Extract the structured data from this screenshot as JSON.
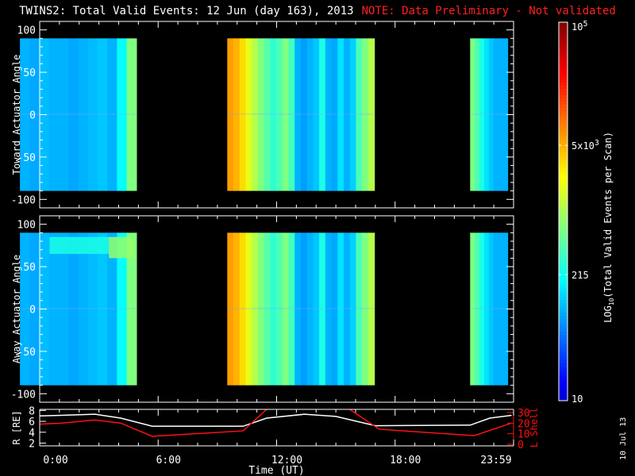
{
  "title": {
    "main": "TWINS2: Total Valid Events: 12 Jun (day 163), 2013",
    "note": "NOTE: Data Preliminary - Not validated",
    "note_color": "#ff2020"
  },
  "date_stamp": "10 Jul 13",
  "chart_data": [
    {
      "type": "heatmap",
      "name": "toward",
      "ylabel": "Toward Actuator Angle",
      "ylim": [
        -110,
        110
      ],
      "yticks": [
        100,
        50,
        0,
        -50,
        -100
      ],
      "yticklabels": [
        "100",
        "50",
        "0",
        "-50",
        "-100"
      ],
      "data_angle_range": [
        -90,
        90
      ],
      "segments": [
        {
          "start": -1.0,
          "end": 4.9,
          "levels": [
            0.3,
            0.29,
            0.31,
            0.3,
            0.3,
            0.29,
            0.3,
            0.31,
            0.32,
            0.3,
            0.38,
            0.5
          ]
        },
        {
          "start": 9.5,
          "end": 16.95,
          "levels": [
            0.72,
            0.7,
            0.66,
            0.6,
            0.55,
            0.5,
            0.46,
            0.42,
            0.45,
            0.5,
            0.44,
            0.3,
            0.28,
            0.3,
            0.32,
            0.4,
            0.3,
            0.29,
            0.35,
            0.3,
            0.33,
            0.45,
            0.5,
            0.55
          ]
        },
        {
          "start": 21.8,
          "end": 23.7,
          "levels": [
            0.5,
            0.45,
            0.4,
            0.35,
            0.32,
            0.3,
            0.3,
            0.3
          ]
        }
      ],
      "patches": []
    },
    {
      "type": "heatmap",
      "name": "away",
      "ylabel": "Away Actuator Angle",
      "ylim": [
        -110,
        110
      ],
      "yticks": [
        100,
        50,
        0,
        -50,
        -100
      ],
      "yticklabels": [
        "100",
        "50",
        "0",
        "-50",
        "-100"
      ],
      "data_angle_range": [
        -90,
        90
      ],
      "segments": [
        {
          "start": -1.0,
          "end": 4.9,
          "levels": [
            0.3,
            0.29,
            0.31,
            0.3,
            0.3,
            0.29,
            0.3,
            0.31,
            0.32,
            0.3,
            0.38,
            0.5
          ]
        },
        {
          "start": 9.5,
          "end": 16.95,
          "levels": [
            0.72,
            0.7,
            0.66,
            0.6,
            0.55,
            0.5,
            0.46,
            0.42,
            0.45,
            0.5,
            0.44,
            0.3,
            0.28,
            0.3,
            0.32,
            0.4,
            0.3,
            0.29,
            0.35,
            0.3,
            0.33,
            0.45,
            0.5,
            0.55
          ]
        },
        {
          "start": 21.8,
          "end": 23.7,
          "levels": [
            0.5,
            0.45,
            0.4,
            0.35,
            0.32,
            0.3,
            0.3,
            0.3
          ]
        }
      ],
      "patches": [
        {
          "start": 0.5,
          "end": 3.5,
          "angle_min": 65,
          "angle_max": 85,
          "level": 0.4
        },
        {
          "start": 3.5,
          "end": 4.8,
          "angle_min": 60,
          "angle_max": 85,
          "level": 0.52
        }
      ]
    },
    {
      "type": "line",
      "name": "ephemeris",
      "xlabel": "Time (UT)",
      "xlim": [
        0,
        24
      ],
      "xticks": [
        0,
        6,
        12,
        18,
        24
      ],
      "xticklabels": [
        "0:00",
        "6:00",
        "12:00",
        "18:00",
        "23:59"
      ],
      "ylabel_left": "R [RE]",
      "ylabel_left_main": "R [R",
      "ylabel_left_sub": "E",
      "ylabel_left_close": "]",
      "ylim_left": [
        1.5,
        8.2
      ],
      "yticks_left": [
        2,
        4,
        6,
        8
      ],
      "yticklabels_left": [
        "2",
        "4",
        "6",
        "8"
      ],
      "ylabel_right": "L Shell",
      "ylim_right": [
        0,
        30
      ],
      "yticks_right": [
        0,
        10,
        20,
        30
      ],
      "yticklabels_right": [
        "0",
        "10",
        "20",
        "30"
      ],
      "series": [
        {
          "name": "R",
          "axis": "left",
          "color": "#ffffff",
          "x": [
            0,
            1.1,
            2.8,
            4.1,
            5.7,
            10.3,
            11.5,
            13.4,
            15.0,
            17.0,
            21.8,
            22.8,
            23.9
          ],
          "y": [
            7.0,
            7.1,
            7.3,
            6.6,
            5.1,
            5.1,
            6.6,
            7.3,
            6.9,
            5.2,
            5.3,
            6.6,
            7.1
          ]
        },
        {
          "name": "L Shell",
          "axis": "right",
          "color": "#ff1010",
          "segments": [
            {
              "x": [
                0,
                1.1,
                2.8,
                4.1,
                5.7,
                10.3,
                11.5
              ],
              "y": [
                19,
                20,
                23,
                20,
                7.5,
                12.7,
                33
              ]
            },
            {
              "x": [
                15.7,
                17.2,
                22.0,
                23.9
              ],
              "y": [
                33,
                14.2,
                8.2,
                20
              ]
            }
          ]
        }
      ]
    },
    {
      "type": "colorbar",
      "name": "colorbar",
      "label_prefix": "LOG",
      "label_sub": "10",
      "label_rest": "(Total Valid Events per Scan)",
      "range": [
        10,
        100000
      ],
      "ticks": [
        {
          "value": 10,
          "label": "10"
        },
        {
          "value": 215,
          "label": "215"
        },
        {
          "value": 5000,
          "label": "5x10",
          "sup": "3"
        },
        {
          "value": 100000,
          "label": "10",
          "sup": "5"
        }
      ]
    }
  ]
}
